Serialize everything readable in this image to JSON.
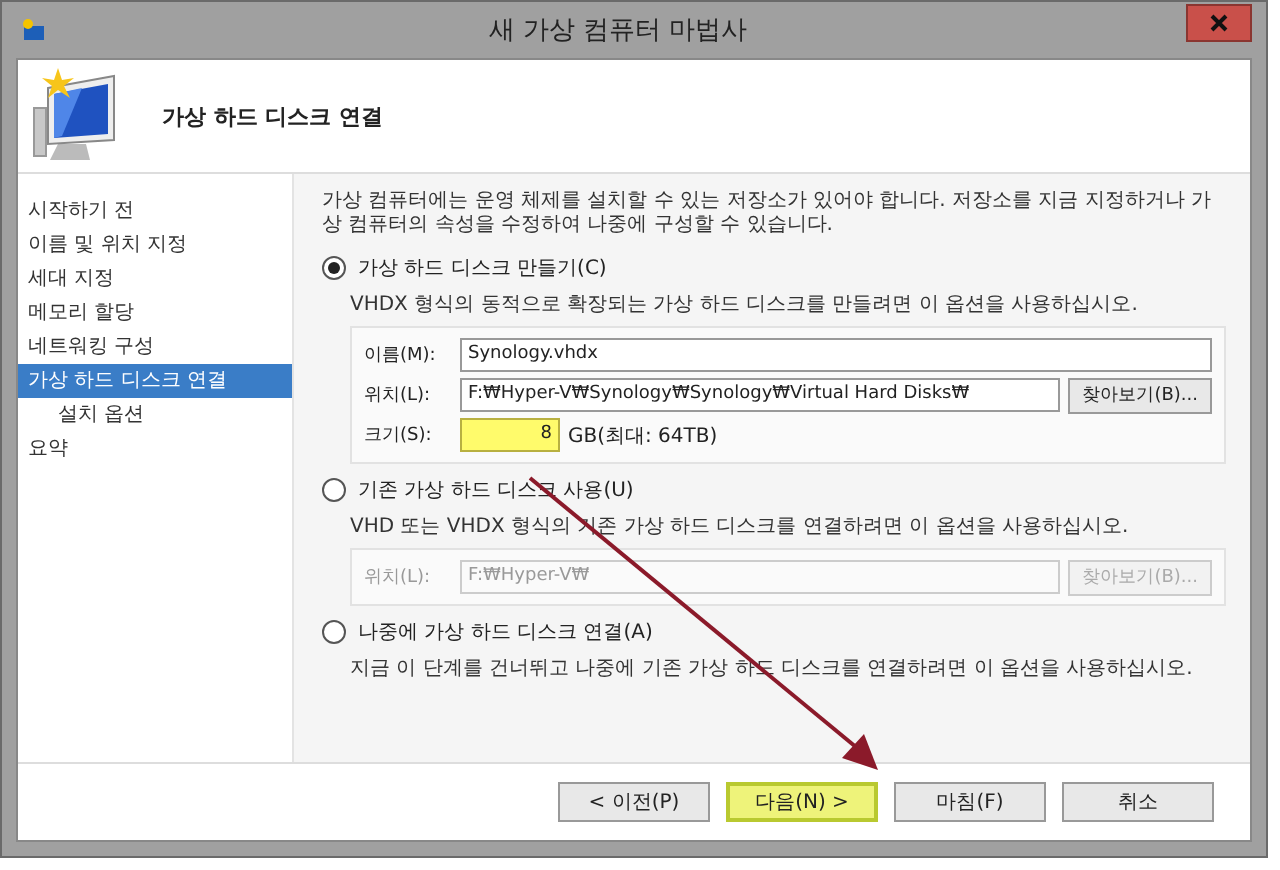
{
  "window": {
    "title": "새 가상 컴퓨터 마법사"
  },
  "header": {
    "title": "가상 하드 디스크 연결"
  },
  "steps": [
    {
      "label": "시작하기 전",
      "selected": false
    },
    {
      "label": "이름 및 위치 지정",
      "selected": false
    },
    {
      "label": "세대 지정",
      "selected": false
    },
    {
      "label": "메모리 할당",
      "selected": false
    },
    {
      "label": "네트워킹 구성",
      "selected": false
    },
    {
      "label": "가상 하드 디스크 연결",
      "selected": true,
      "children": [
        {
          "label": "설치 옵션",
          "selected": false
        }
      ]
    },
    {
      "label": "요약",
      "selected": false
    }
  ],
  "intro": "가상 컴퓨터에는 운영 체제를 설치할 수 있는 저장소가 있어야 합니다. 저장소를 지금 지정하거나 가상 컴퓨터의 속성을 수정하여 나중에 구성할 수 있습니다.",
  "options": [
    {
      "label": "가상 하드 디스크 만들기(C)",
      "selected": true,
      "description": "VHDX 형식의 동적으로 확장되는 가상 하드 디스크를 만들려면 이 옵션을 사용하십시오.",
      "fields": [
        {
          "kind": "text",
          "label": "이름(M):",
          "value": "Synology.vhdx",
          "disabled": false
        },
        {
          "kind": "path",
          "label": "위치(L):",
          "value": "F:₩Hyper-V₩Synology₩Synology₩Virtual Hard Disks₩",
          "button": "찾아보기(B)...",
          "disabled": false
        },
        {
          "kind": "size",
          "label": "크기(S):",
          "value": "8",
          "unit": "GB(최대: 64TB)",
          "highlighted": true,
          "disabled": false
        }
      ]
    },
    {
      "label": "기존 가상 하드 디스크 사용(U)",
      "selected": false,
      "description": "VHD 또는 VHDX 형식의 기존 가상 하드 디스크를 연결하려면 이 옵션을 사용하십시오.",
      "fields": [
        {
          "kind": "path",
          "label": "위치(L):",
          "value": "F:₩Hyper-V₩",
          "button": "찾아보기(B)...",
          "disabled": true
        }
      ]
    },
    {
      "label": "나중에 가상 하드 디스크 연결(A)",
      "selected": false,
      "description": "지금 이 단계를 건너뛰고 나중에 기존 가상 하드 디스크를 연결하려면 이 옵션을 사용하십시오."
    }
  ],
  "buttons": [
    {
      "label": "< 이전(P)",
      "highlighted": false
    },
    {
      "label": "다음(N) >",
      "highlighted": true
    },
    {
      "label": "마침(F)",
      "highlighted": false
    },
    {
      "label": "취소",
      "highlighted": false
    }
  ]
}
